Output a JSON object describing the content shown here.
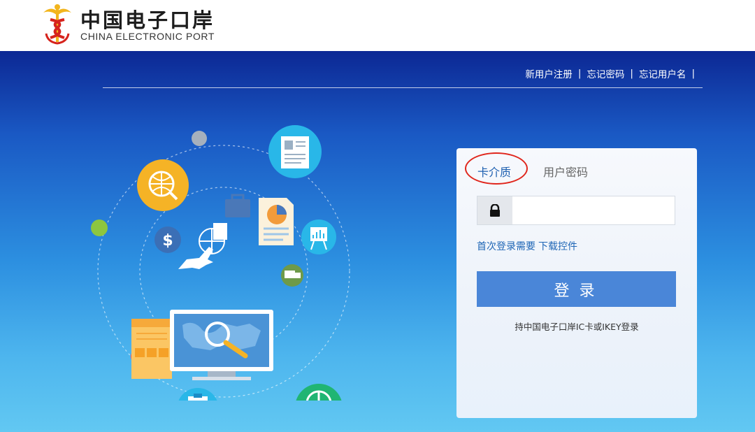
{
  "header": {
    "brand_cn": "中国电子口岸",
    "brand_en": "CHINA ELECTRONIC PORT",
    "logo_icon": "caduceus-logo-icon"
  },
  "top_links": {
    "register": "新用户注册",
    "forgot_password": "忘记密码",
    "forgot_username": "忘记用户名",
    "separator": "|"
  },
  "login": {
    "tabs": [
      "卡介质",
      "用户密码"
    ],
    "active_tab": "卡介质",
    "pin_placeholder": "",
    "lock_icon": "lock-icon",
    "hint_text": "首次登录需要",
    "hint_link": "下载控件",
    "button_label": "登录",
    "note": "持中国电子口岸IC卡或IKEY登录"
  },
  "colors": {
    "accent_blue": "#4a86d8",
    "tab_active": "#1d5fb0",
    "highlight_ring": "#e0261c",
    "banner_top": "#0c2894",
    "banner_bottom": "#62c8f2"
  }
}
